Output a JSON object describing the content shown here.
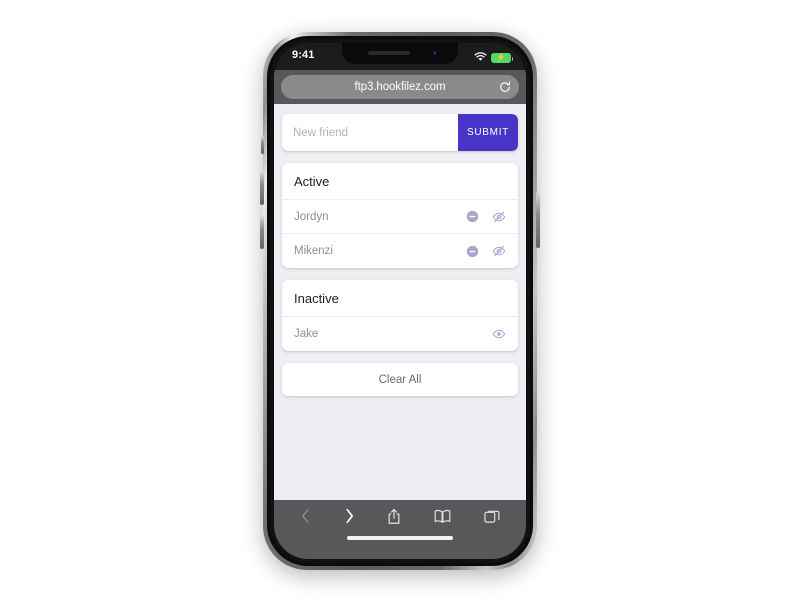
{
  "device": {
    "name": "iphone-x",
    "frame_color": "#5c5c5c"
  },
  "status_bar": {
    "time": "9:41",
    "wifi_icon": "wifi-icon",
    "battery_icon": "battery-charging-icon",
    "battery_color": "#53d769"
  },
  "browser": {
    "name": "safari",
    "url": "ftp3.hookfilez.com",
    "reload_icon": "reload-icon",
    "toolbar": {
      "back_icon": "chevron-left-icon",
      "forward_icon": "chevron-right-icon",
      "share_icon": "share-icon",
      "bookmarks_icon": "book-icon",
      "tabs_icon": "tabs-icon",
      "back_enabled": false,
      "forward_enabled": true
    }
  },
  "page": {
    "background": "#efeff3",
    "accent_color": "#4834c8",
    "compose": {
      "input_value": "",
      "input_placeholder": "New friend",
      "submit_label": "SUBMIT"
    },
    "sections": [
      {
        "title": "Active",
        "rows": [
          {
            "name": "Jordyn",
            "actions": [
              {
                "icon": "minus-circle-icon",
                "label": "deactivate"
              },
              {
                "icon": "eye-off-icon",
                "label": "hide"
              }
            ]
          },
          {
            "name": "Mikenzi",
            "actions": [
              {
                "icon": "minus-circle-icon",
                "label": "deactivate"
              },
              {
                "icon": "eye-off-icon",
                "label": "hide"
              }
            ]
          }
        ]
      },
      {
        "title": "Inactive",
        "rows": [
          {
            "name": "Jake",
            "actions": [
              {
                "icon": "eye-icon",
                "label": "show"
              }
            ]
          }
        ]
      }
    ],
    "clear_all_label": "Clear All"
  }
}
